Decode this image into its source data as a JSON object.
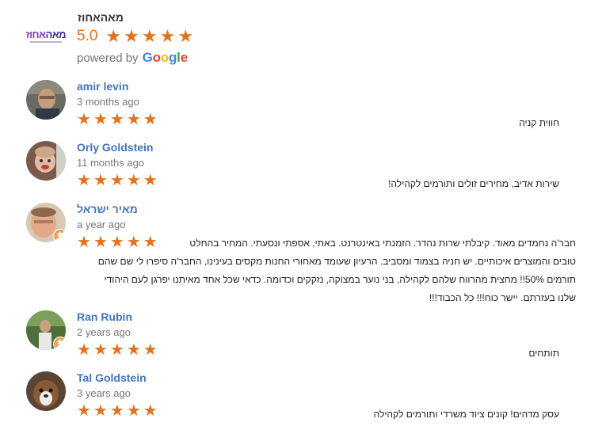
{
  "business": {
    "logo_text_a": "מאה",
    "logo_text_b": "אחוז",
    "name": "מאהאחוז",
    "rating": "5.0",
    "stars": 5,
    "powered_by": "powered by",
    "google_letters": [
      "G",
      "o",
      "o",
      "g",
      "l",
      "e"
    ],
    "google_colors": [
      "#4285F4",
      "#EA4335",
      "#FBBC05",
      "#4285F4",
      "#34A853",
      "#EA4335"
    ]
  },
  "colors": {
    "star": "#e7711b",
    "name_link": "#4273c5"
  },
  "reviews": [
    {
      "name": "amir levin",
      "time": "3 months ago",
      "stars": 5,
      "text": "חווית קניה",
      "avatar": "person-photo"
    },
    {
      "name": "Orly Goldstein",
      "time": "11 months ago",
      "stars": 5,
      "text": "שירות אדיב, מחירים זולים ותורמים לקהילה!",
      "avatar": "child-photo"
    },
    {
      "name": "מאיר ישראל",
      "time": "a year ago",
      "stars": 5,
      "avatar": "person-photo",
      "text_lines": [
        "חבר'ה נחמדים מאוד. קיבלתי שרות נהדר. הזמנתי באינטרנט. באתי, אספתי ונסעתי. המחיר בהחלט",
        "טובים והמוצרים איכותיים. יש חניה בצמוד ומסביב. הרעיון שעומד מאחורי החנות מקסים בעינינו, החבר'ה סיפרו לי שם שהם",
        "תורמים 50%!! מחצית מהרווח שלהם לקהילה, בני נוער במצוקה, נזקקים וכדומה. כדאי שכל אחד מאיתנו יפרגן לעם היהודי",
        "שלנו בעזרתם. יישר כוח!!! כל הכבוד!!!"
      ]
    },
    {
      "name": "Ran Rubin",
      "time": "2 years ago",
      "stars": 5,
      "text": "תותחים",
      "avatar": "outdoor-photo"
    },
    {
      "name": "Tal Goldstein",
      "time": "3 years ago",
      "stars": 5,
      "text": "עסק מדהים! קונים ציוד משרדי ותורמים לקהילה",
      "avatar": "dog-photo"
    }
  ]
}
